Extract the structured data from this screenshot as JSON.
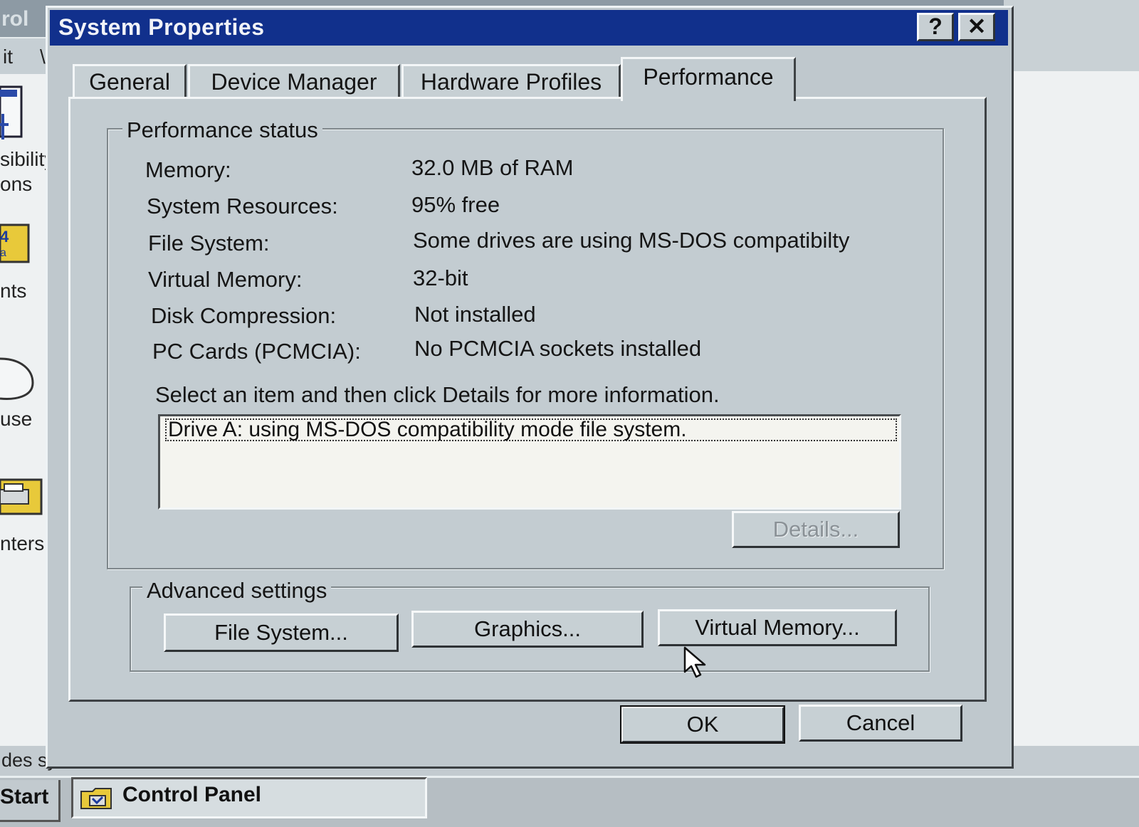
{
  "background_window": {
    "title_fragment": "rol",
    "menu_fragment": "it",
    "menu_fragment_2": "\\",
    "icon_labels": [
      "sibility",
      "ons",
      "nts",
      "use",
      "nters"
    ],
    "status_fragment": "des syst"
  },
  "taskbar": {
    "start_label": "Start",
    "task_label": "Control Panel"
  },
  "dialog": {
    "title": "System Properties",
    "help_button": "?",
    "close_button": "✕",
    "tabs": [
      {
        "label": "General",
        "active": false
      },
      {
        "label": "Device Manager",
        "active": false
      },
      {
        "label": "Hardware Profiles",
        "active": false
      },
      {
        "label": "Performance",
        "active": true
      }
    ],
    "performance_status": {
      "group_label": "Performance status",
      "rows": [
        {
          "label": "Memory:",
          "value": "32.0 MB of RAM"
        },
        {
          "label": "System Resources:",
          "value": "95% free"
        },
        {
          "label": "File System:",
          "value": "Some drives are using MS-DOS compatibilty"
        },
        {
          "label": "Virtual Memory:",
          "value": "32-bit"
        },
        {
          "label": "Disk Compression:",
          "value": "Not installed"
        },
        {
          "label": "PC Cards (PCMCIA):",
          "value": "No PCMCIA sockets installed"
        }
      ],
      "instruction": "Select an item and then click Details for more information.",
      "list_items": [
        "Drive A: using MS-DOS compatibility mode file system."
      ],
      "details_button": "Details..."
    },
    "advanced_settings": {
      "group_label": "Advanced settings",
      "file_system_button": "File System...",
      "graphics_button": "Graphics...",
      "virtual_memory_button": "Virtual Memory..."
    },
    "ok_button": "OK",
    "cancel_button": "Cancel"
  },
  "colors": {
    "titlebar": "#11308c",
    "dialog_face": "#c3ccd1",
    "listbox_bg": "#f4f4ef"
  }
}
